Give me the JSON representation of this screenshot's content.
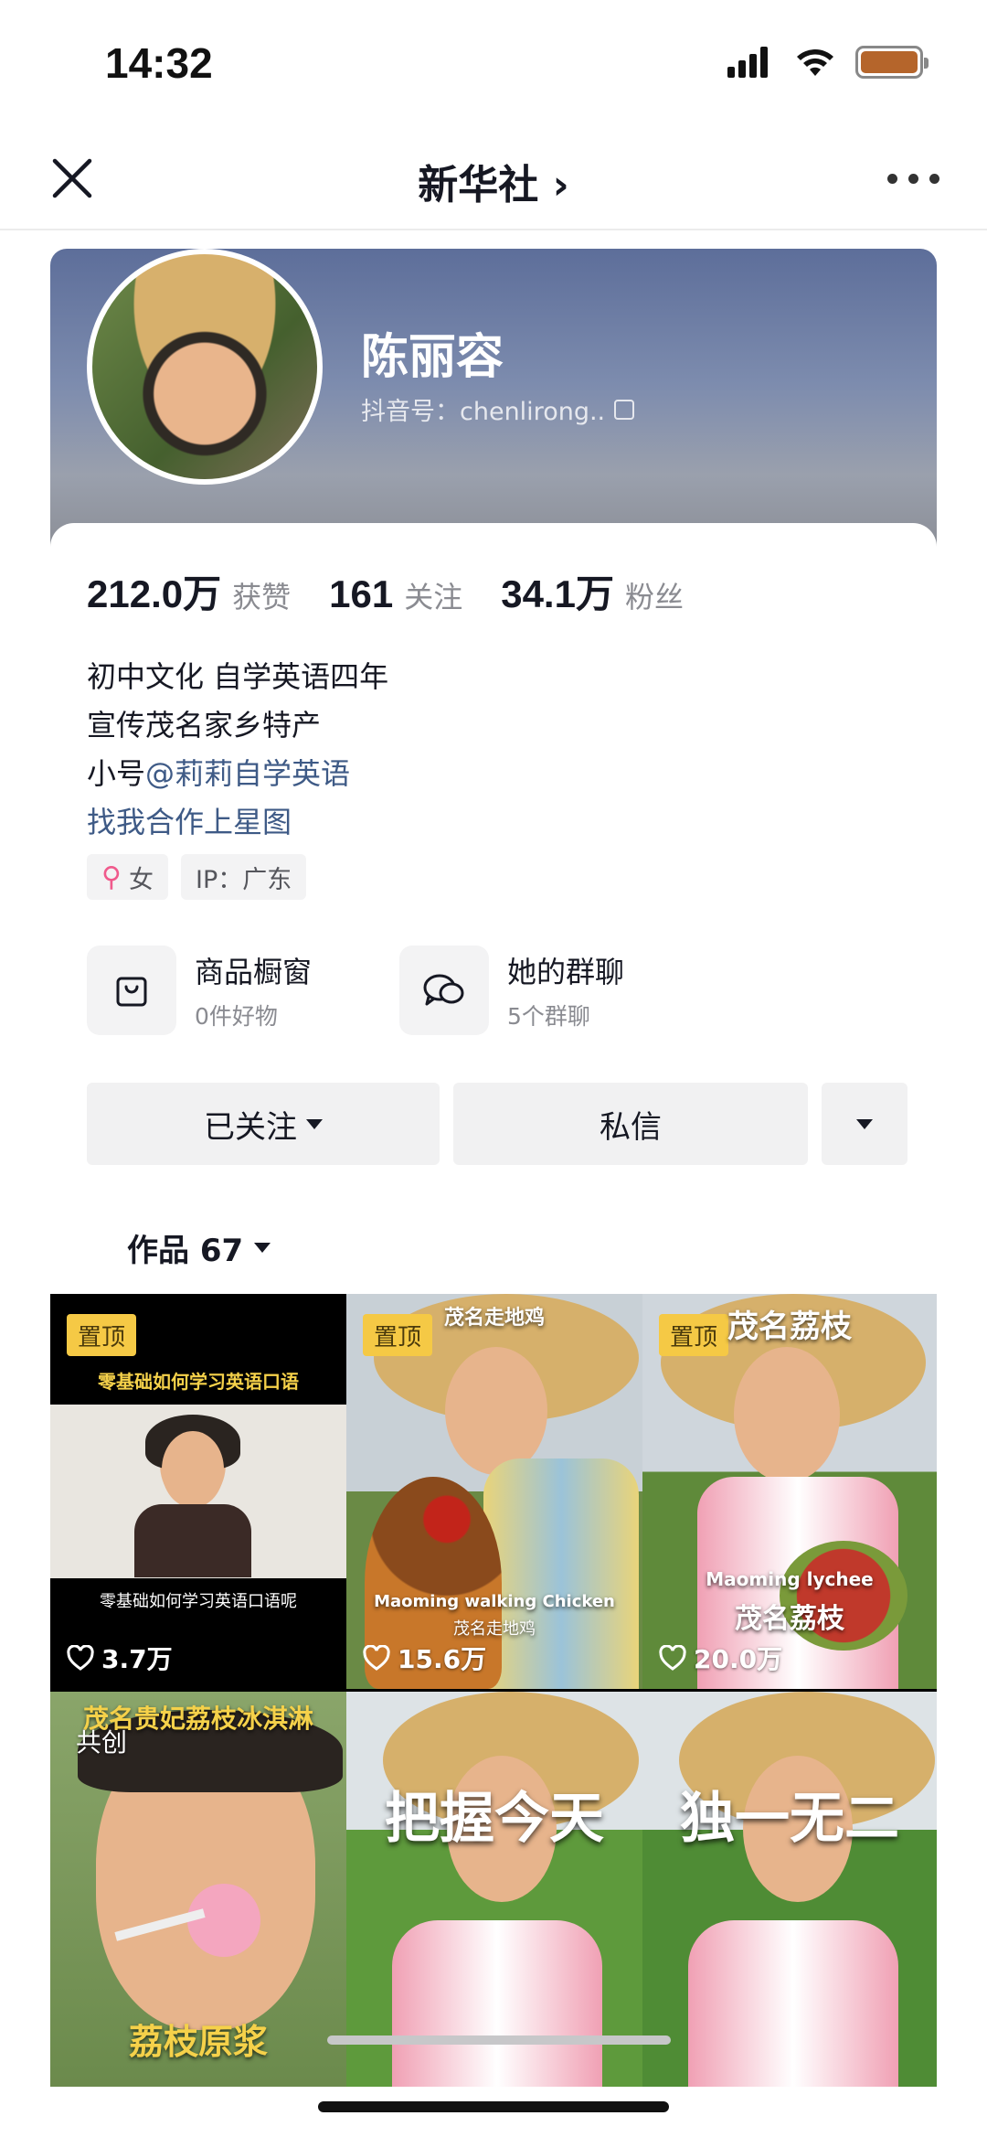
{
  "status": {
    "time": "14:32"
  },
  "nav": {
    "title": "新华社 ›"
  },
  "profile": {
    "name": "陈丽容",
    "douyin_id": "抖音号：chenlirong..",
    "stats": [
      {
        "value": "212.0万",
        "label": "获赞"
      },
      {
        "value": "161",
        "label": "关注"
      },
      {
        "value": "34.1万",
        "label": "粉丝"
      }
    ],
    "bio": {
      "line1": "初中文化 自学英语四年",
      "line2": "宣传茂名家乡特产",
      "line3_prefix": "小号",
      "line3_link": "@莉莉自学英语",
      "line4_link": "找我合作上星图"
    },
    "tags": {
      "gender_symbol": "⚲",
      "gender": "女",
      "ip": "IP：广东"
    }
  },
  "shortcuts": [
    {
      "title": "商品橱窗",
      "subtitle": "0件好物",
      "icon": "shop-bag-icon"
    },
    {
      "title": "她的群聊",
      "subtitle": "5个群聊",
      "icon": "chat-bubbles-icon"
    }
  ],
  "actions": {
    "follow": "已关注",
    "message": "私信"
  },
  "works": {
    "tab_label": "作品 67"
  },
  "videos": [
    {
      "pinned": "置顶",
      "likes": "3.7万",
      "caption_top": "零基础如何学习英语口语",
      "caption_bottom": "零基础如何学习英语口语呢"
    },
    {
      "pinned": "置顶",
      "likes": "15.6万",
      "caption_top": "茂名走地鸡",
      "caption_en": "Maoming walking Chicken",
      "caption_bottom": "茂名走地鸡"
    },
    {
      "pinned": "置顶",
      "likes": "20.0万",
      "caption_top": "茂名荔枝",
      "caption_en": "Maoming lychee",
      "caption_bottom": "茂名荔枝"
    },
    {
      "caption_top": "茂名贵妃荔枝冰淇淋",
      "collab": "共创",
      "caption_bottom": "荔枝原浆"
    },
    {
      "overlay": "把握今天"
    },
    {
      "overlay": "独一无二"
    }
  ]
}
